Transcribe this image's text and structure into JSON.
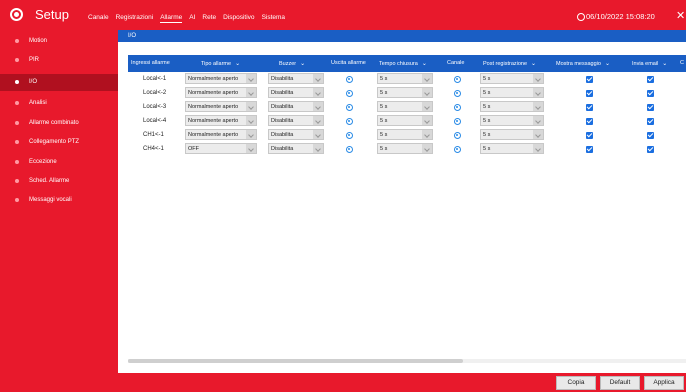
{
  "app": {
    "title": "Setup",
    "datetime": "06/10/2022 15:08:20"
  },
  "topnav": [
    "Canale",
    "Registrazioni",
    "Allarme",
    "AI",
    "Rete",
    "Dispositivo",
    "Sistema"
  ],
  "sidebar": [
    {
      "label": "Motion"
    },
    {
      "label": "PIR"
    },
    {
      "label": "I/O"
    },
    {
      "label": "Analisi"
    },
    {
      "label": "Allarme combinato"
    },
    {
      "label": "Collegamento PTZ"
    },
    {
      "label": "Eccezione"
    },
    {
      "label": "Sched. Allarme"
    },
    {
      "label": "Messaggi vocali"
    }
  ],
  "tab": {
    "label": "I/O"
  },
  "table": {
    "headers": {
      "input": "Ingressi allarme",
      "type": "Tipo allarme",
      "buzzer": "Buzzer",
      "output": "Uscita allarme",
      "close_time": "Tempo chiusura",
      "channel": "Canale",
      "post_rec": "Post registrazione",
      "show_msg": "Mostra messaggio",
      "send_email": "Invia email",
      "overflow": "C"
    },
    "rows": [
      {
        "input": "Local<-1",
        "type": "Normalmente aperto",
        "buzzer": "Disabilita",
        "close_time": "5 s",
        "post_rec": "5 s"
      },
      {
        "input": "Local<-2",
        "type": "Normalmente aperto",
        "buzzer": "Disabilita",
        "close_time": "5 s",
        "post_rec": "5 s"
      },
      {
        "input": "Local<-3",
        "type": "Normalmente aperto",
        "buzzer": "Disabilita",
        "close_time": "5 s",
        "post_rec": "5 s"
      },
      {
        "input": "Local<-4",
        "type": "Normalmente aperto",
        "buzzer": "Disabilita",
        "close_time": "5 s",
        "post_rec": "5 s"
      },
      {
        "input": "CH1<-1",
        "type": "Normalmente aperto",
        "buzzer": "Disabilita",
        "close_time": "5 s",
        "post_rec": "5 s"
      },
      {
        "input": "CH4<-1",
        "type": "OFF",
        "buzzer": "Disabilita",
        "close_time": "5 s",
        "post_rec": "5 s"
      }
    ]
  },
  "buttons": {
    "copy": "Copia",
    "default": "Default",
    "apply": "Applica"
  },
  "colors": {
    "brand": "#e8192c",
    "header": "#1a5ec4",
    "active_side": "#b0101f"
  }
}
